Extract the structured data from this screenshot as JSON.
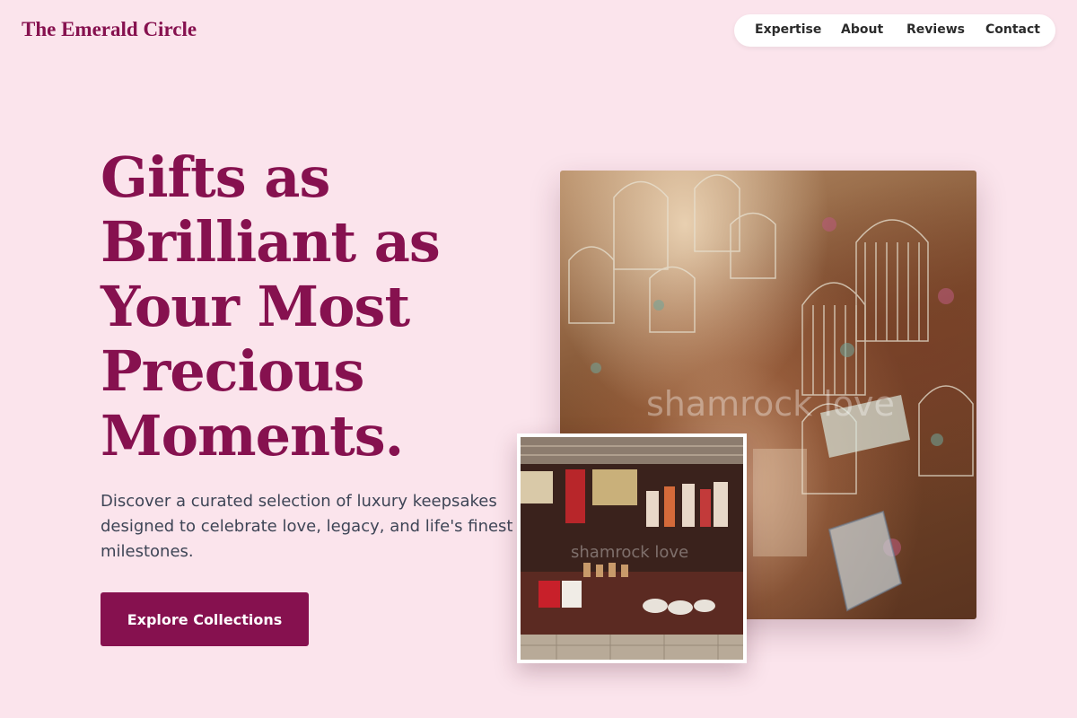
{
  "brand": {
    "name": "The Emerald Circle"
  },
  "nav": {
    "items": [
      {
        "label": "Expertise"
      },
      {
        "label": "About"
      },
      {
        "label": "Reviews"
      },
      {
        "label": "Contact"
      }
    ]
  },
  "hero": {
    "headline": "Gifts as Brilliant as Your Most Precious Moments.",
    "subtext": "Discover a curated selection of luxury keepsakes designed to celebrate love, legacy, and life's finest milestones.",
    "cta_label": "Explore Collections"
  },
  "images": {
    "main_watermark": "shamrock love",
    "small_watermark": "shamrock love"
  },
  "colors": {
    "background": "#fbe4ec",
    "accent": "#86114f",
    "nav_background": "#ffffff",
    "body_text": "#3e4556"
  }
}
